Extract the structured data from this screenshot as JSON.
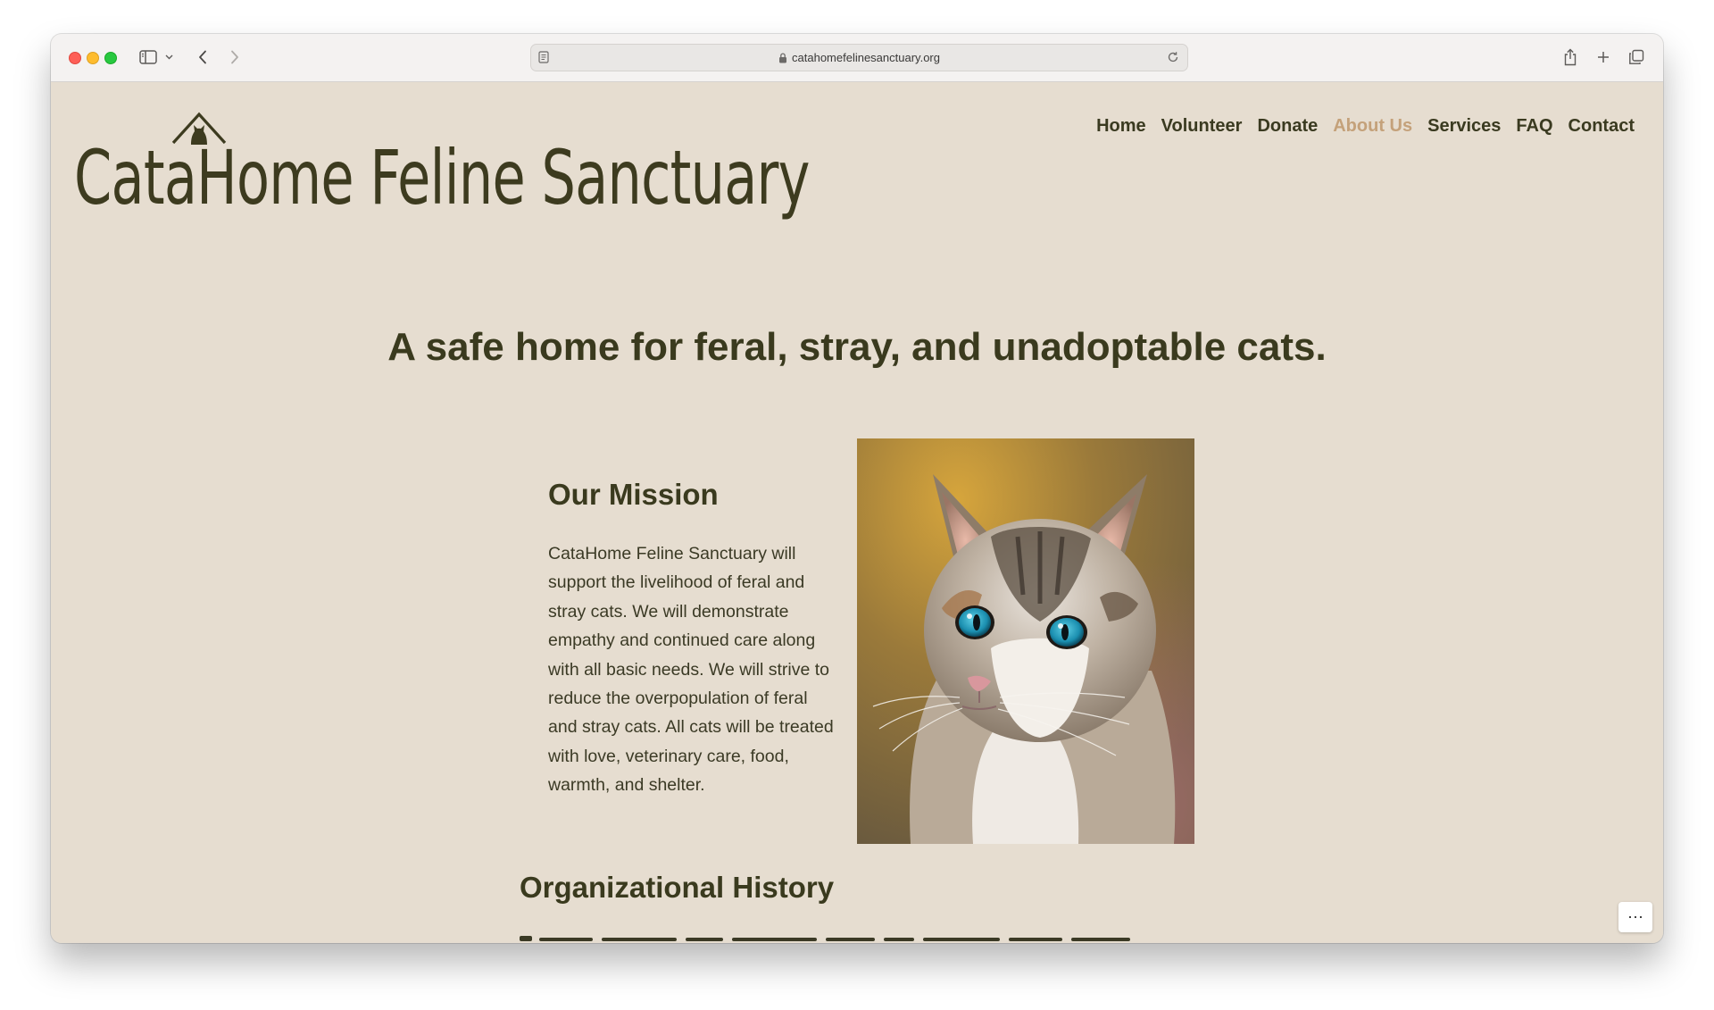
{
  "browser": {
    "url": "catahomefelinesanctuary.org"
  },
  "site": {
    "title": "CataHome Feline Sanctuary"
  },
  "nav": {
    "items": [
      {
        "label": "Home",
        "active": false
      },
      {
        "label": "Volunteer",
        "active": false
      },
      {
        "label": "Donate",
        "active": false
      },
      {
        "label": "About Us",
        "active": true
      },
      {
        "label": "Services",
        "active": false
      },
      {
        "label": "FAQ",
        "active": false
      },
      {
        "label": "Contact",
        "active": false
      }
    ]
  },
  "hero": {
    "heading": "A safe home for feral, stray, and unadoptable cats."
  },
  "mission": {
    "title": "Our Mission",
    "text": "CataHome Feline Sanctuary will support the livelihood of feral and stray cats. We will demonstrate empathy and continued care along with all basic needs. We will strive to reduce the overpopulation of feral and stray cats. All cats will be treated with love, veterinary care, food, warmth, and shelter."
  },
  "history": {
    "title": "Organizational History"
  },
  "colors": {
    "page_bg": "#e6ddd0",
    "text_dark": "#3a3a1e",
    "nav_active": "#c4a17a"
  },
  "icons": [
    "sidebar-toggle-icon",
    "chevron-down-icon",
    "back-arrow-icon",
    "forward-arrow-icon",
    "reader-icon",
    "lock-icon",
    "reload-icon",
    "share-icon",
    "new-tab-icon",
    "tabs-overview-icon",
    "more-icon",
    "house-cat-logo-icon"
  ]
}
